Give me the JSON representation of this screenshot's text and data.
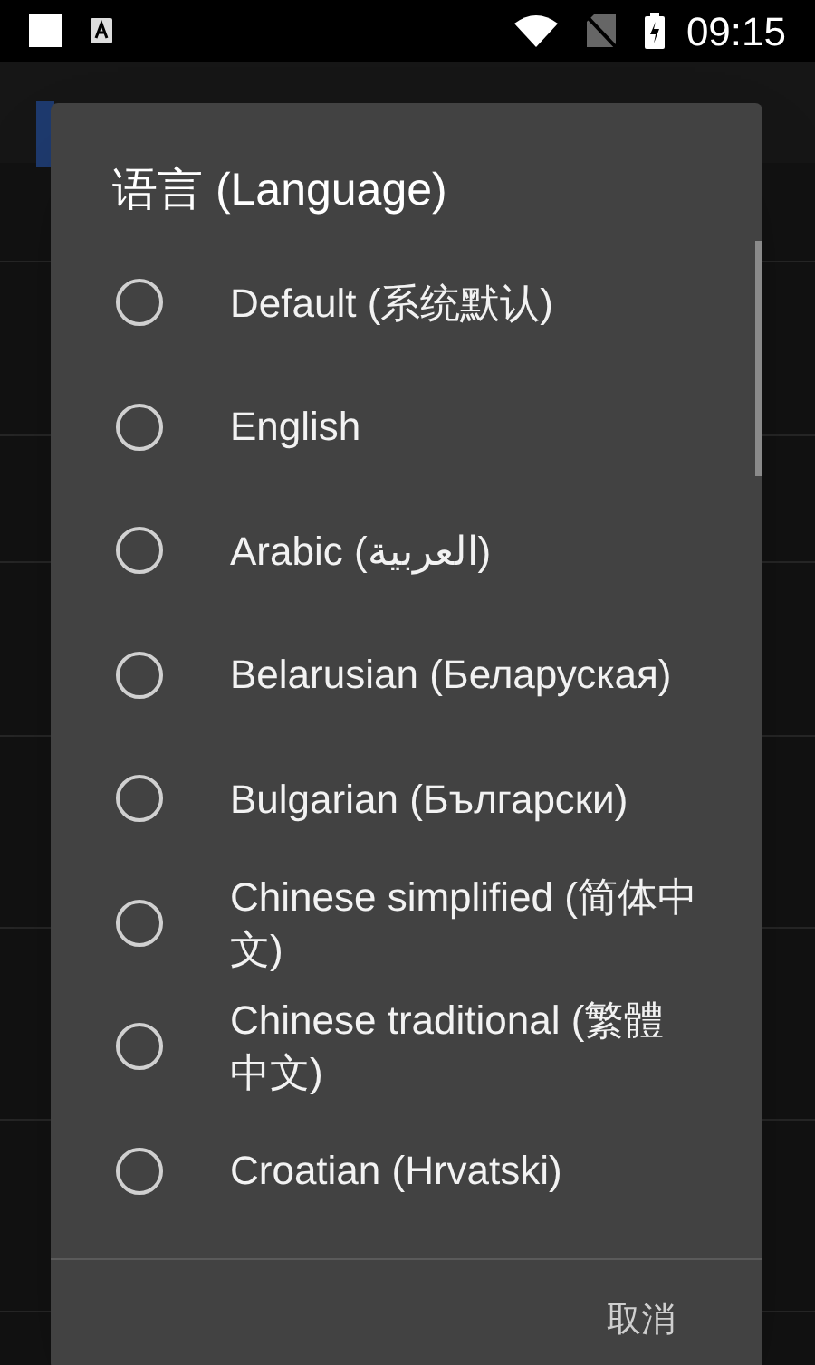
{
  "status_bar": {
    "time": "09:15"
  },
  "dialog": {
    "title": "语言 (Language)",
    "options": [
      {
        "label": "Default (系统默认)",
        "selected": false
      },
      {
        "label": "English",
        "selected": false
      },
      {
        "label": "Arabic (العربية)",
        "selected": false
      },
      {
        "label": "Belarusian (Беларуская)",
        "selected": false
      },
      {
        "label": "Bulgarian (Български)",
        "selected": false
      },
      {
        "label": "Chinese simplified (简体中文)",
        "selected": false
      },
      {
        "label": "Chinese traditional (繁體中文)",
        "selected": false
      },
      {
        "label": "Croatian (Hrvatski)",
        "selected": false
      }
    ],
    "cancel_button": "取消"
  }
}
